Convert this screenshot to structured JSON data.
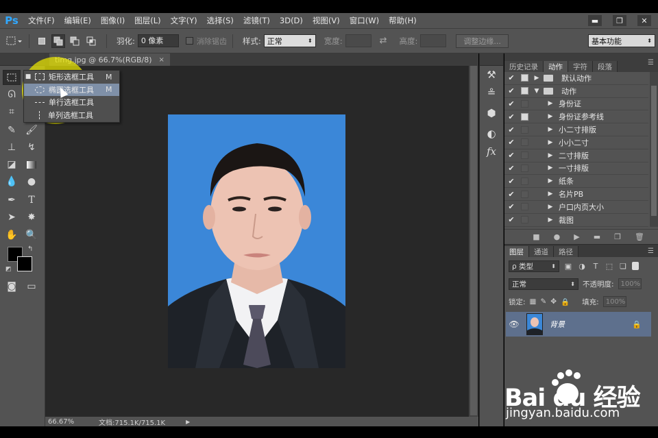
{
  "app": {
    "logo": "Ps"
  },
  "menu": [
    "文件(F)",
    "编辑(E)",
    "图像(I)",
    "图层(L)",
    "文字(Y)",
    "选择(S)",
    "滤镜(T)",
    "3D(D)",
    "视图(V)",
    "窗口(W)",
    "帮助(H)"
  ],
  "window_controls": {
    "minimize": "▬",
    "restore": "❐",
    "close": "✕"
  },
  "options": {
    "feather_label": "羽化:",
    "feather_value": "0 像素",
    "antialias_label": "消除锯齿",
    "style_label": "样式:",
    "style_value": "正常",
    "width_label": "宽度:",
    "height_label": "高度:",
    "refine_button": "调整边缘...",
    "workspace_value": "基本功能"
  },
  "document": {
    "tab_title": "timg.jpg @ 66.7%(RGB/8)",
    "close_glyph": "×",
    "zoom": "66.67%",
    "doc_info": "文档:715.1K/715.1K"
  },
  "flyout": {
    "items": [
      {
        "label": "矩形选框工具",
        "key": "M",
        "bullet": "■"
      },
      {
        "label": "椭圆选框工具",
        "key": "M",
        "bullet": ""
      },
      {
        "label": "单行选框工具",
        "key": "",
        "bullet": ""
      },
      {
        "label": "单列选框工具",
        "key": "",
        "bullet": ""
      }
    ]
  },
  "actions_panel": {
    "tabs": [
      "历史记录",
      "动作",
      "字符",
      "段落"
    ],
    "active_tab": "动作",
    "rows": [
      {
        "label": "默认动作",
        "check": "✔",
        "box": true,
        "folder": true,
        "tri": "▶",
        "indent": 0
      },
      {
        "label": "动作",
        "check": "✔",
        "box": true,
        "folder": true,
        "tri": "▼",
        "indent": 0
      },
      {
        "label": "身份证",
        "check": "✔",
        "box": false,
        "folder": false,
        "tri": "▶",
        "indent": 1
      },
      {
        "label": "身份证参考线",
        "check": "✔",
        "box": true,
        "folder": false,
        "tri": "▶",
        "indent": 1
      },
      {
        "label": "小二寸排版",
        "check": "✔",
        "box": false,
        "folder": false,
        "tri": "▶",
        "indent": 1
      },
      {
        "label": "小小二寸",
        "check": "✔",
        "box": false,
        "folder": false,
        "tri": "▶",
        "indent": 1
      },
      {
        "label": "二寸排版",
        "check": "✔",
        "box": false,
        "folder": false,
        "tri": "▶",
        "indent": 1
      },
      {
        "label": "一寸排版",
        "check": "✔",
        "box": false,
        "folder": false,
        "tri": "▶",
        "indent": 1
      },
      {
        "label": "纸条",
        "check": "✔",
        "box": false,
        "folder": false,
        "tri": "▶",
        "indent": 1
      },
      {
        "label": "名片PB",
        "check": "✔",
        "box": false,
        "folder": false,
        "tri": "▶",
        "indent": 1
      },
      {
        "label": "户口内页大小",
        "check": "✔",
        "box": false,
        "folder": false,
        "tri": "▶",
        "indent": 1
      },
      {
        "label": "裁图",
        "check": "✔",
        "box": false,
        "folder": false,
        "tri": "▶",
        "indent": 1
      }
    ]
  },
  "layers_panel": {
    "tabs": [
      "图层",
      "通道",
      "路径"
    ],
    "active_tab": "图层",
    "kind_label": "ρ 类型",
    "blend_mode": "正常",
    "opacity_label": "不透明度:",
    "opacity_value": "100%",
    "lock_label": "锁定:",
    "fill_label": "填充:",
    "fill_value": "100%",
    "layer_name": "背景"
  },
  "watermark": {
    "logo": "Bai du 经验",
    "url": "jingyan.baidu.com"
  }
}
